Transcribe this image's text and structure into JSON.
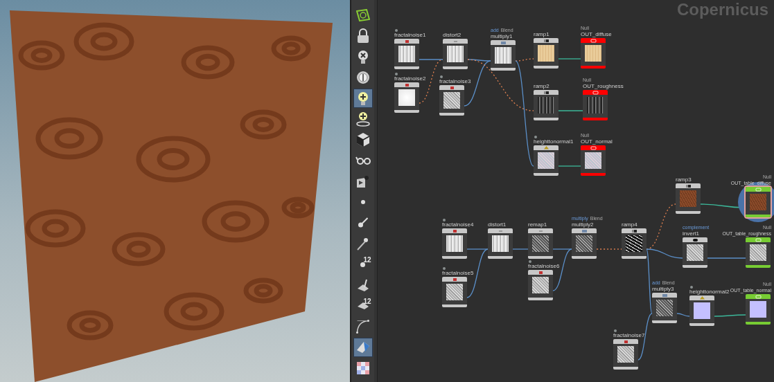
{
  "toolbar": [
    {
      "kind": "view",
      "selected": false
    },
    {
      "kind": "lock",
      "selected": false
    },
    {
      "kind": "light-off",
      "selected": false
    },
    {
      "kind": "dial",
      "selected": false
    },
    {
      "kind": "light-add",
      "selected": true
    },
    {
      "kind": "light-target",
      "selected": false
    },
    {
      "kind": "cube",
      "selected": false
    },
    {
      "kind": "glasses",
      "selected": false
    },
    {
      "kind": "camera",
      "selected": false
    },
    {
      "kind": "point",
      "selected": false
    },
    {
      "kind": "point-normal",
      "selected": false
    },
    {
      "kind": "point-line",
      "selected": false
    },
    {
      "kind": "point-number",
      "selected": false,
      "label": "12"
    },
    {
      "kind": "prim-normal",
      "selected": false
    },
    {
      "kind": "prim-number",
      "selected": false,
      "label": "12"
    },
    {
      "kind": "curve",
      "selected": false
    },
    {
      "kind": "shade",
      "selected": true
    },
    {
      "kind": "checker",
      "selected": false
    }
  ],
  "network": {
    "title": "Copernicus",
    "nodes": [
      {
        "name": "fractalnoise1",
        "kind": "generator",
        "flagged": true,
        "selected": false
      },
      {
        "name": "distort2",
        "kind": "filter",
        "selected": false
      },
      {
        "name": "multiply1",
        "kind": "blend",
        "tag": "add",
        "subtag": "Blend",
        "selected": false
      },
      {
        "name": "ramp1",
        "kind": "ramp",
        "selected": false
      },
      {
        "name": "OUT_diffuse",
        "kind": "output",
        "tag": "Null",
        "color": "#ff0000",
        "selected": false
      },
      {
        "name": "fractalnoise2",
        "kind": "generator",
        "flagged": true,
        "selected": false
      },
      {
        "name": "fractalnoise3",
        "kind": "generator",
        "flagged": true,
        "selected": false
      },
      {
        "name": "ramp2",
        "kind": "ramp",
        "selected": false
      },
      {
        "name": "OUT_roughness",
        "kind": "output",
        "tag": "Null",
        "color": "#ff0000",
        "selected": false
      },
      {
        "name": "heighttonormal1",
        "kind": "normal",
        "flagged": true,
        "selected": false
      },
      {
        "name": "OUT_normal",
        "kind": "output",
        "tag": "Null",
        "color": "#ff0000",
        "selected": false
      },
      {
        "name": "ramp3",
        "kind": "ramp",
        "selected": false
      },
      {
        "name": "OUT_table_diffuse",
        "kind": "output",
        "tag": "Null",
        "color": "#77cc33",
        "selected": true
      },
      {
        "name": "fractalnoise4",
        "kind": "generator",
        "flagged": true,
        "selected": false
      },
      {
        "name": "distort1",
        "kind": "filter",
        "selected": false
      },
      {
        "name": "remap1",
        "kind": "filter",
        "selected": false
      },
      {
        "name": "multiply2",
        "kind": "blend",
        "tag": "multiply",
        "subtag": "Blend",
        "selected": false
      },
      {
        "name": "ramp4",
        "kind": "ramp",
        "selected": false
      },
      {
        "name": "invert1",
        "kind": "invert",
        "tag": "complement",
        "selected": false
      },
      {
        "name": "OUT_table_roughness",
        "kind": "output",
        "tag": "Null",
        "color": "#77cc33",
        "selected": false
      },
      {
        "name": "fractalnoise5",
        "kind": "generator",
        "flagged": true,
        "selected": false
      },
      {
        "name": "fractalnoise6",
        "kind": "generator",
        "flagged": true,
        "selected": false
      },
      {
        "name": "multiply3",
        "kind": "blend",
        "tag": "add",
        "subtag": "Blend",
        "selected": false
      },
      {
        "name": "heighttonormal2",
        "kind": "normal",
        "flagged": true,
        "selected": false
      },
      {
        "name": "OUT_table_normal",
        "kind": "output",
        "tag": "Null",
        "color": "#77cc33",
        "selected": false
      },
      {
        "name": "fractalnoise7",
        "kind": "generator",
        "flagged": true,
        "selected": false
      }
    ]
  }
}
